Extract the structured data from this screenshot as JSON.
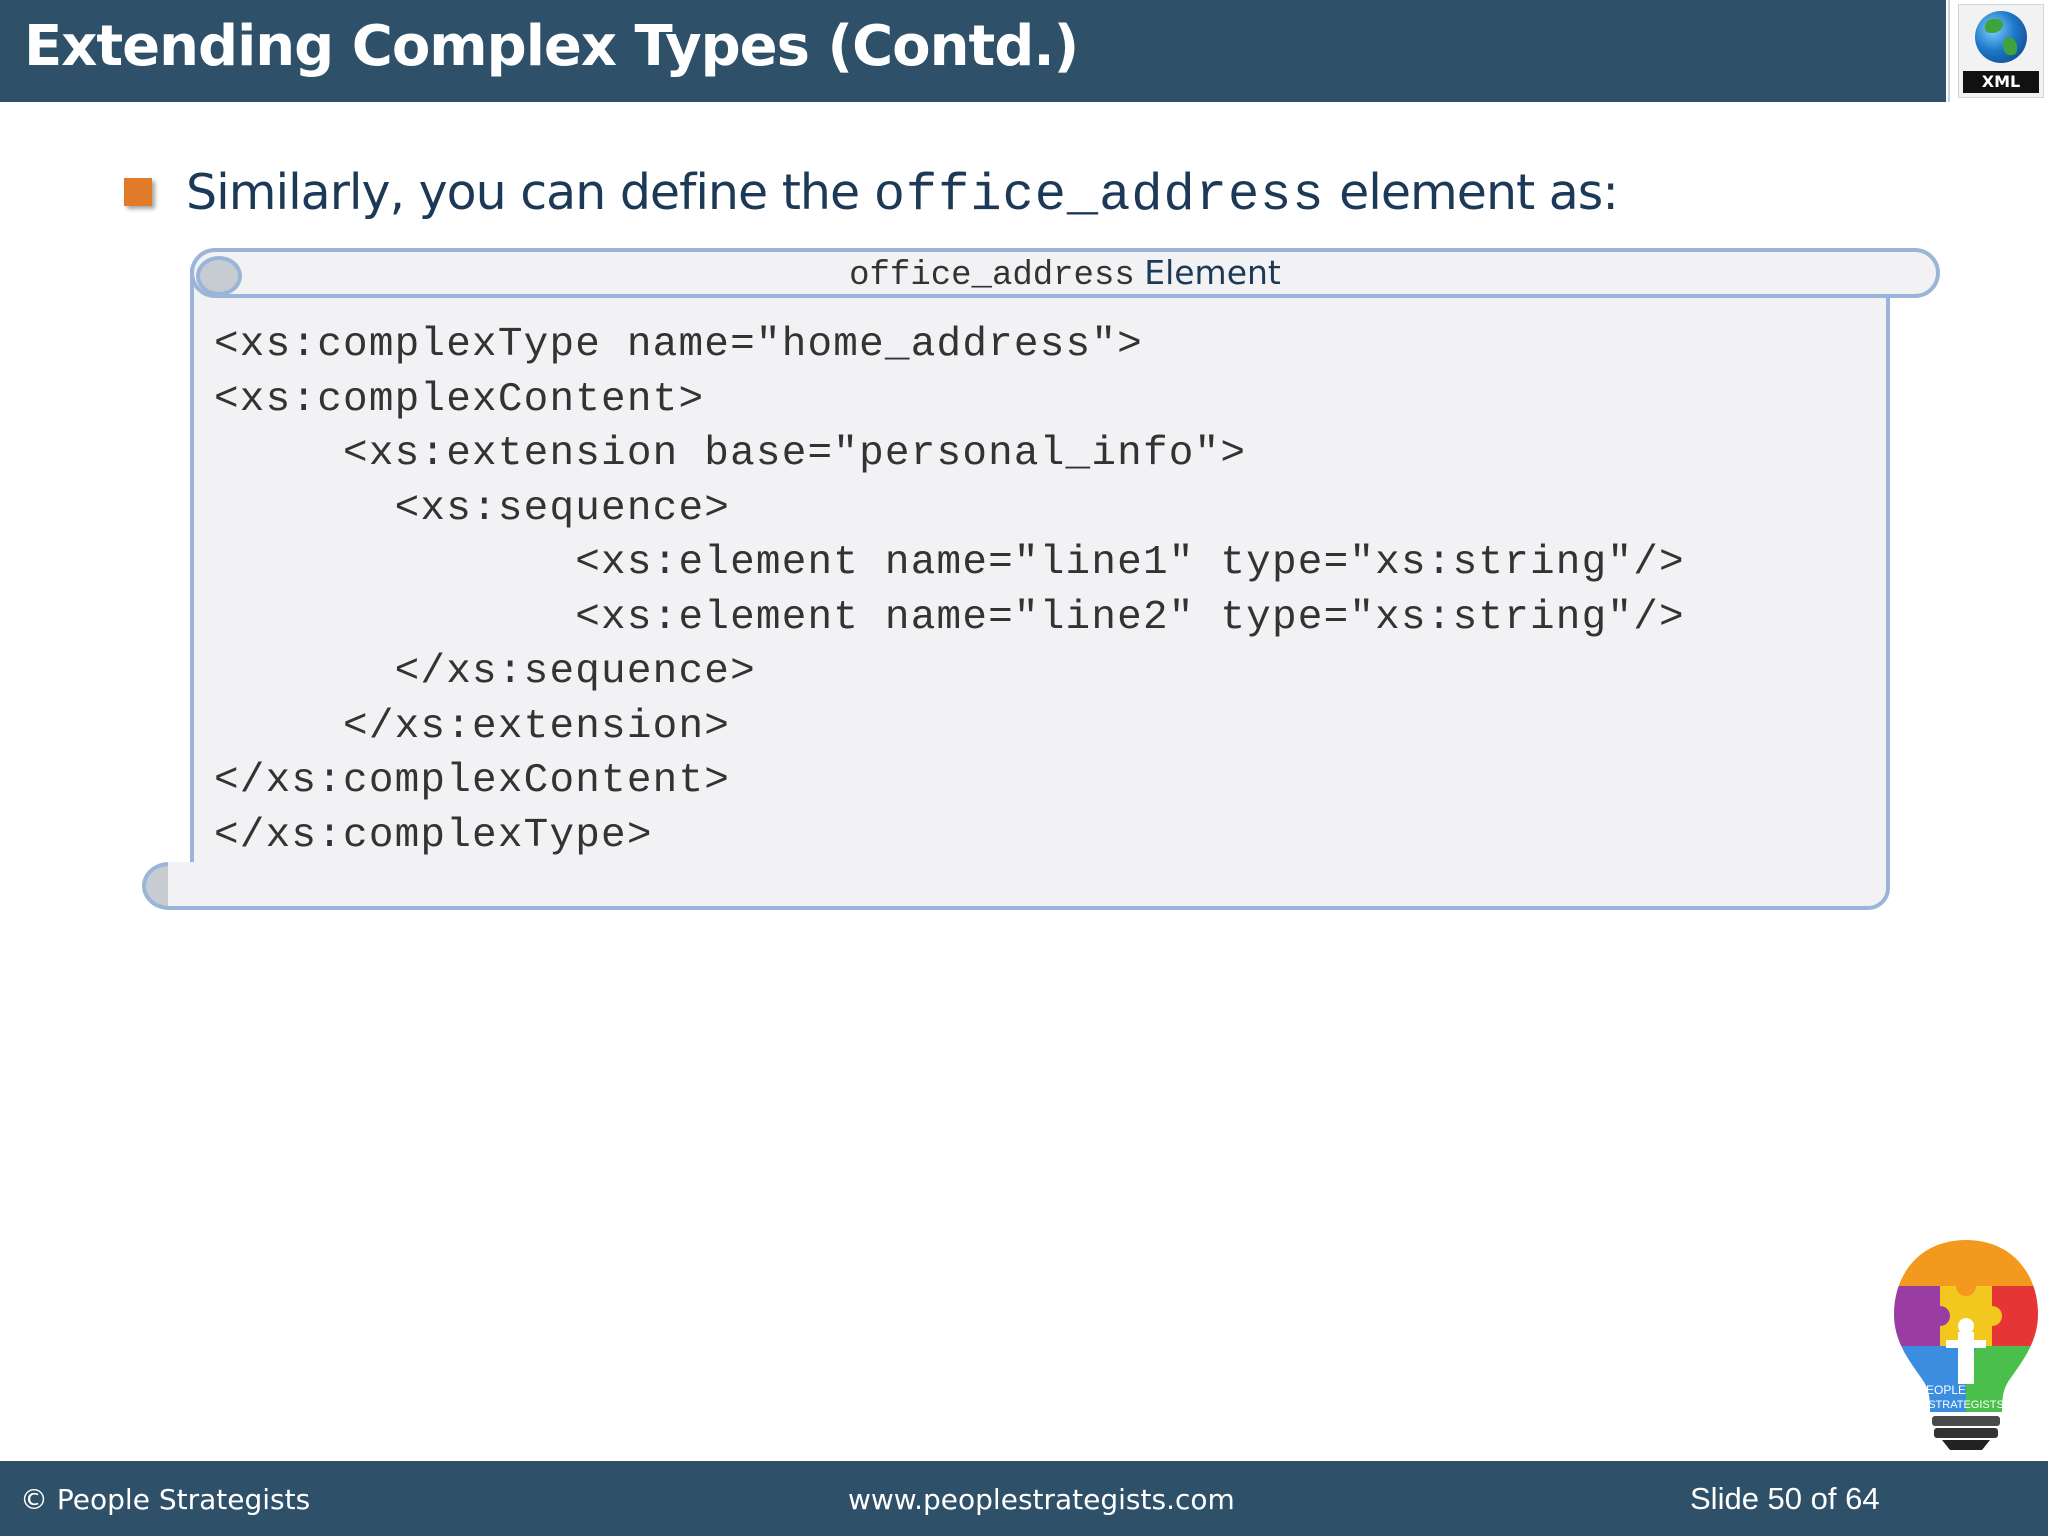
{
  "header": {
    "title": "Extending Complex Types (Contd.)",
    "logo_label": "XML",
    "logo_icon": "globe-icon",
    "background": "#2e5068"
  },
  "bullet": {
    "text_before": "Similarly, you can define the ",
    "code_term": "office_address",
    "text_after": " element as:",
    "marker_color": "#e07b2a"
  },
  "code_box": {
    "title_code": "office_address",
    "title_text": "Element",
    "border_color": "#9bb5d9",
    "lines": [
      "<xs:complexType name=\"home_address\">",
      "<xs:complexContent>",
      "     <xs:extension base=\"personal_info\">",
      "       <xs:sequence>",
      "              <xs:element name=\"line1\" type=\"xs:string\"/>",
      "              <xs:element name=\"line2\" type=\"xs:string\"/>",
      "       </xs:sequence>",
      "     </xs:extension>",
      "</xs:complexContent>",
      "</xs:complexType>"
    ]
  },
  "brand_logo": {
    "icon": "lightbulb-puzzle-icon",
    "text_line1": "PEOPLE",
    "text_line2": "STRATEGISTS"
  },
  "footer": {
    "copyright": "© People Strategists",
    "website": "www.peoplestrategists.com",
    "slide_label": "Slide 50 of 64"
  }
}
